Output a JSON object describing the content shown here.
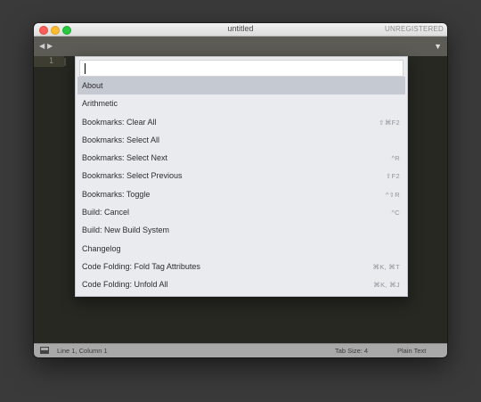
{
  "window": {
    "title": "untitled",
    "license_status": "UNREGISTERED"
  },
  "tabbar": {
    "back_icon": "◀",
    "forward_icon": "▶",
    "menu_icon": "▼"
  },
  "editor": {
    "line_number": "1"
  },
  "palette": {
    "input_value": "",
    "items": [
      {
        "label": "About",
        "shortcut": "",
        "selected": true
      },
      {
        "label": "Arithmetic",
        "shortcut": ""
      },
      {
        "label": "Bookmarks: Clear All",
        "shortcut": "⇧⌘F2"
      },
      {
        "label": "Bookmarks: Select All",
        "shortcut": ""
      },
      {
        "label": "Bookmarks: Select Next",
        "shortcut": "^R"
      },
      {
        "label": "Bookmarks: Select Previous",
        "shortcut": "⇧F2"
      },
      {
        "label": "Bookmarks: Toggle",
        "shortcut": "^⇧R"
      },
      {
        "label": "Build: Cancel",
        "shortcut": "^C"
      },
      {
        "label": "Build: New Build System",
        "shortcut": ""
      },
      {
        "label": "Changelog",
        "shortcut": ""
      },
      {
        "label": "Code Folding: Fold Tag Attributes",
        "shortcut": "⌘K, ⌘T"
      },
      {
        "label": "Code Folding: Unfold All",
        "shortcut": "⌘K, ⌘J"
      }
    ]
  },
  "statusbar": {
    "position": "Line 1, Column 1",
    "tab_size": "Tab Size: 4",
    "syntax": "Plain Text"
  },
  "colors": {
    "editor_bg": "#272822",
    "palette_bg": "#e9ebef",
    "selected_item_bg": "#c4c9d2"
  }
}
